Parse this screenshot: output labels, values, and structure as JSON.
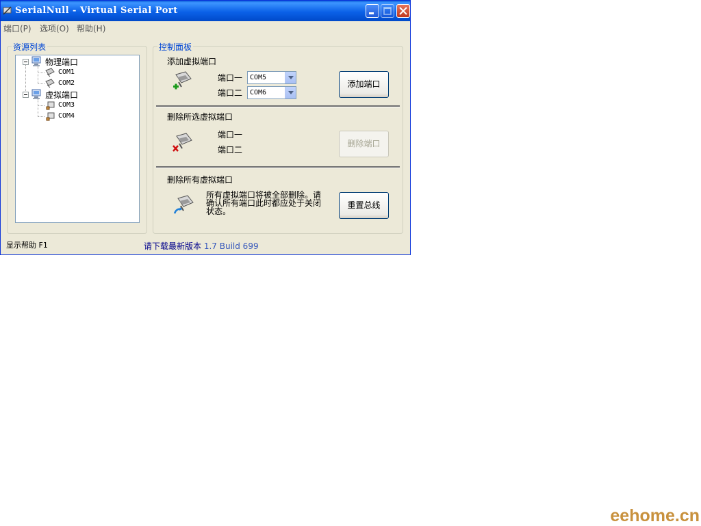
{
  "window": {
    "title": "SerialNull - Virtual Serial Port"
  },
  "menu": {
    "items": [
      "端口(P)",
      "选项(O)",
      "帮助(H)"
    ]
  },
  "resources": {
    "label": "资源列表",
    "tree": [
      {
        "label": "物理端口",
        "children": [
          "COM1",
          "COM2"
        ]
      },
      {
        "label": "虚拟端口",
        "children": [
          "COM3",
          "COM4"
        ]
      }
    ]
  },
  "control": {
    "label": "控制面板",
    "add": {
      "title": "添加虚拟端口",
      "port1_label": "端口一",
      "port2_label": "端口二",
      "port1_value": "COM5",
      "port2_value": "COM6",
      "button": "添加端口"
    },
    "remove_selected": {
      "title": "删除所选虚拟端口",
      "port1_label": "端口一",
      "port2_label": "端口二",
      "button": "删除端口"
    },
    "remove_all": {
      "title": "删除所有虚拟端口",
      "message": "所有虚拟端口将被全部删除。请确认所有端口此时都应处于关闭状态。",
      "button": "重置总线"
    }
  },
  "status": {
    "help": "显示帮助 F1",
    "update_prefix": "请下载最新版本",
    "update_version": "1.7 Build 699"
  },
  "watermark": "eehome.cn",
  "colors": {
    "titlebar": "#0b61e8",
    "group_label": "#0046d5",
    "update_link": "#00008b",
    "version": "#3355bb",
    "watermark": "#c8913d"
  }
}
